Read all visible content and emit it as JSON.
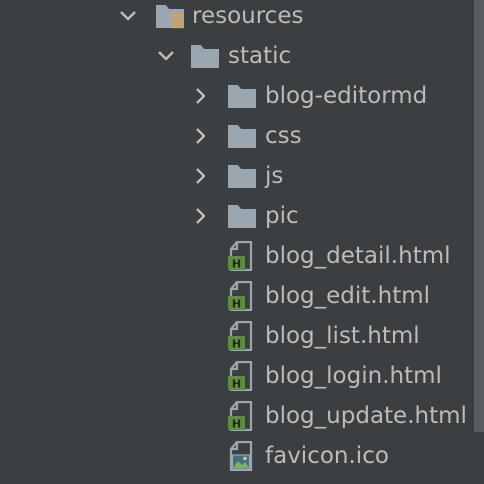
{
  "tree": {
    "items": [
      {
        "label": "resources",
        "icon": "resources-folder-icon",
        "expanded": true,
        "level": 0
      },
      {
        "label": "static",
        "icon": "folder-icon",
        "expanded": true,
        "level": 1
      },
      {
        "label": "blog-editormd",
        "icon": "folder-icon",
        "expanded": false,
        "level": 2
      },
      {
        "label": "css",
        "icon": "folder-icon",
        "expanded": false,
        "level": 2
      },
      {
        "label": "js",
        "icon": "folder-icon",
        "expanded": false,
        "level": 2
      },
      {
        "label": "pic",
        "icon": "folder-icon",
        "expanded": false,
        "level": 2
      },
      {
        "label": "blog_detail.html",
        "icon": "html-file-icon",
        "level": 3
      },
      {
        "label": "blog_edit.html",
        "icon": "html-file-icon",
        "level": 3
      },
      {
        "label": "blog_list.html",
        "icon": "html-file-icon",
        "level": 3
      },
      {
        "label": "blog_login.html",
        "icon": "html-file-icon",
        "level": 3
      },
      {
        "label": "blog_update.html",
        "icon": "html-file-icon",
        "level": 3
      },
      {
        "label": "favicon.ico",
        "icon": "image-file-icon",
        "level": 3
      }
    ]
  },
  "colors": {
    "background": "#3c3f41",
    "text": "#bbbbbb",
    "folder": "#9aa7b0",
    "html_badge": "#5f8d3e",
    "resources_badge": "#d9a343"
  }
}
